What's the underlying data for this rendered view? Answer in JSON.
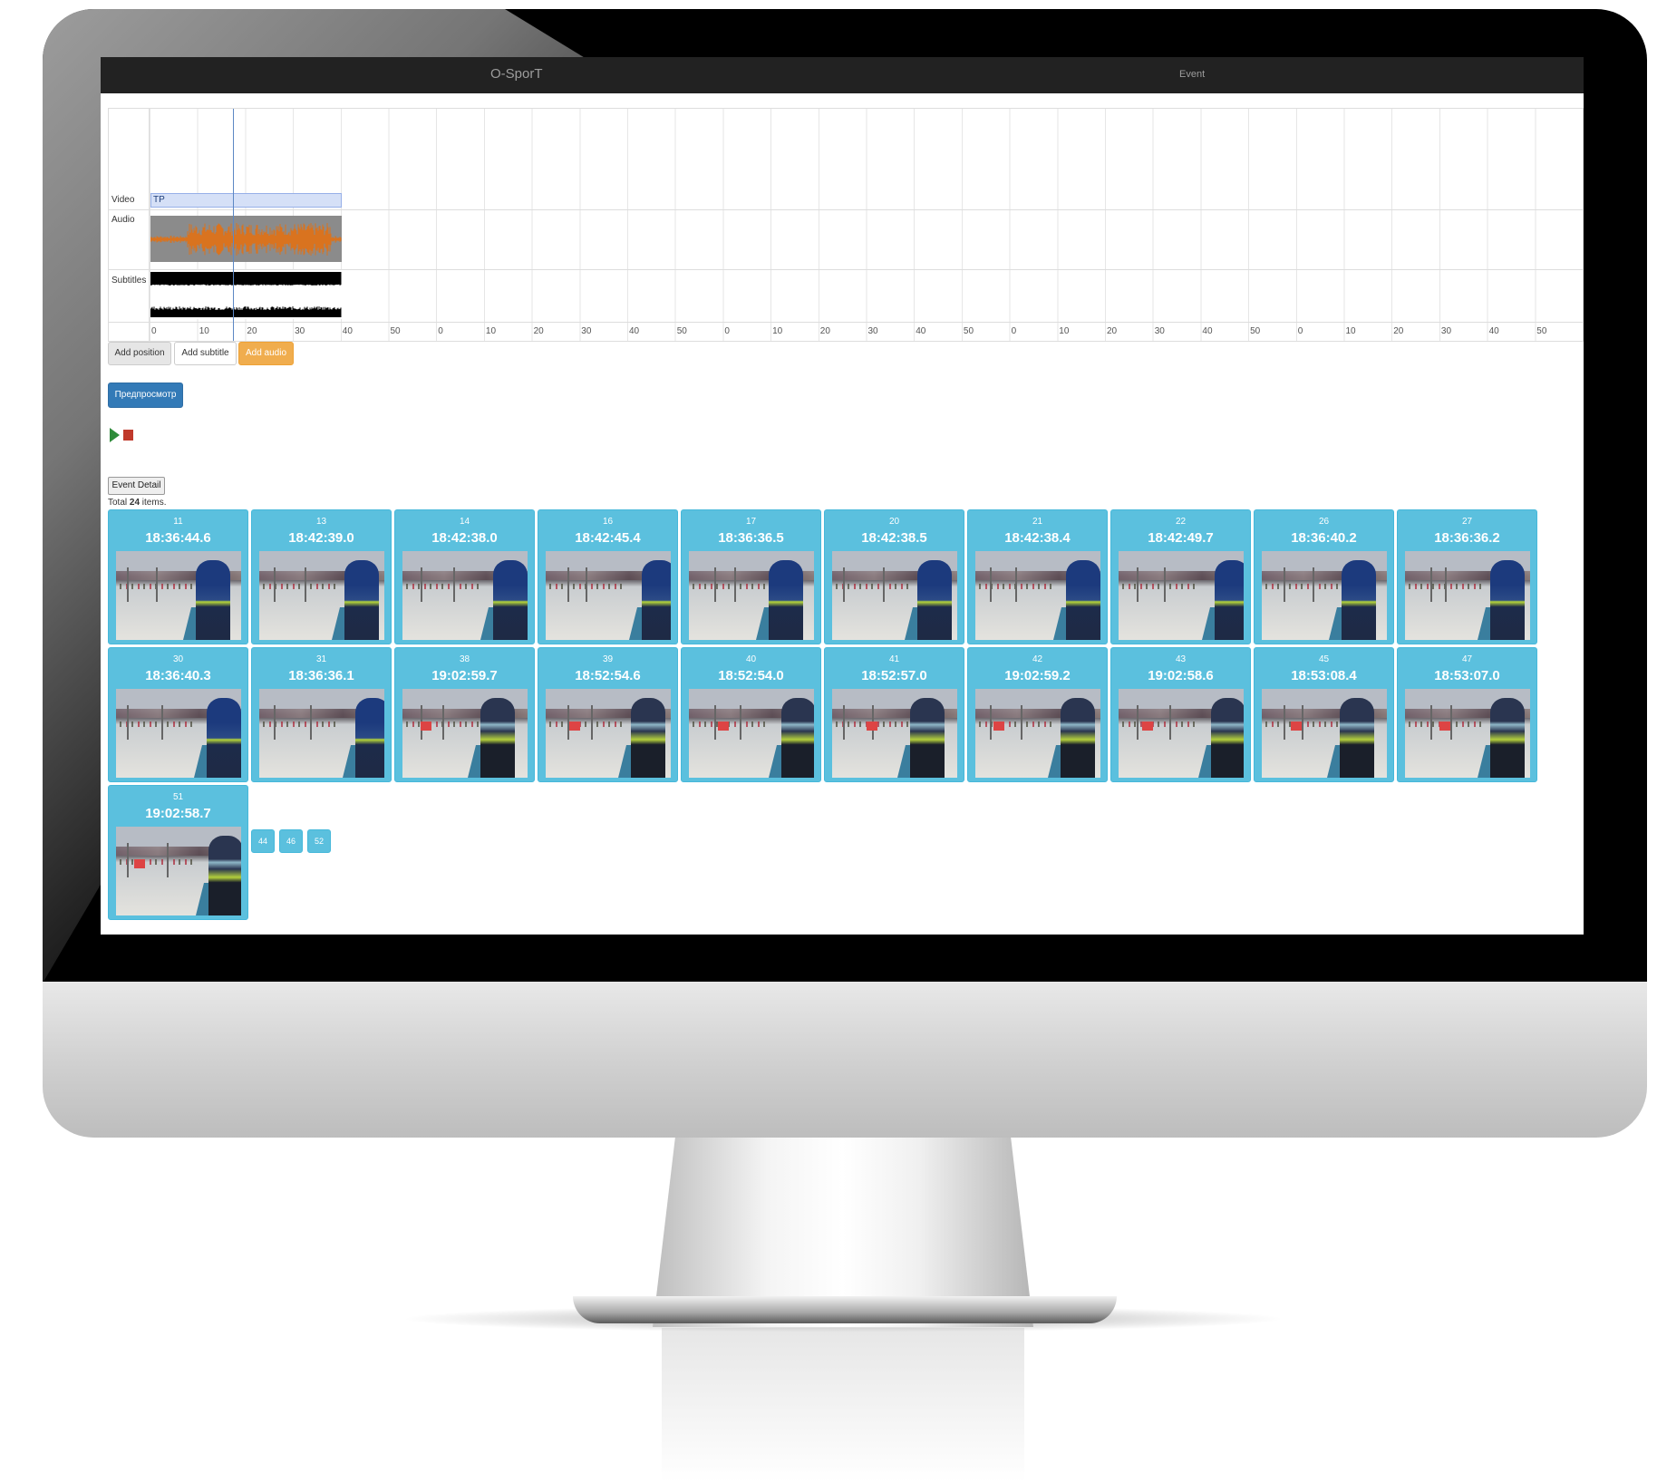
{
  "app": {
    "brand": "O-SporT",
    "nav_link": "Event"
  },
  "timeline": {
    "tracks": {
      "video": "Video",
      "audio": "Audio",
      "subtitles": "Subtitles"
    },
    "video_clip_label": "TP",
    "ticks": [
      "0",
      "10",
      "20",
      "30",
      "40",
      "50",
      "0",
      "10",
      "20",
      "30",
      "40",
      "50",
      "0",
      "10",
      "20",
      "30",
      "40",
      "50",
      "0",
      "10",
      "20",
      "30",
      "40",
      "50",
      "0",
      "10",
      "20",
      "30",
      "40",
      "50"
    ]
  },
  "buttons": {
    "add_position": "Add position",
    "add_subtitle": "Add subtitle",
    "add_audio": "Add audio",
    "preview": "Предпросмотр",
    "event_detail": "Event Detail"
  },
  "summary": {
    "prefix": "Total ",
    "count": "24",
    "suffix": " items."
  },
  "tiles": [
    {
      "id": "11",
      "time": "18:36:44.6"
    },
    {
      "id": "13",
      "time": "18:42:39.0"
    },
    {
      "id": "14",
      "time": "18:42:38.0"
    },
    {
      "id": "16",
      "time": "18:42:45.4"
    },
    {
      "id": "17",
      "time": "18:36:36.5"
    },
    {
      "id": "20",
      "time": "18:42:38.5"
    },
    {
      "id": "21",
      "time": "18:42:38.4"
    },
    {
      "id": "22",
      "time": "18:42:49.7"
    },
    {
      "id": "26",
      "time": "18:36:40.2"
    },
    {
      "id": "27",
      "time": "18:36:36.2"
    },
    {
      "id": "30",
      "time": "18:36:40.3"
    },
    {
      "id": "31",
      "time": "18:36:36.1"
    },
    {
      "id": "38",
      "time": "19:02:59.7"
    },
    {
      "id": "39",
      "time": "18:52:54.6"
    },
    {
      "id": "40",
      "time": "18:52:54.0"
    },
    {
      "id": "41",
      "time": "18:52:57.0"
    },
    {
      "id": "42",
      "time": "19:02:59.2"
    },
    {
      "id": "43",
      "time": "19:02:58.6"
    },
    {
      "id": "45",
      "time": "18:53:08.4"
    },
    {
      "id": "47",
      "time": "18:53:07.0"
    },
    {
      "id": "51",
      "time": "19:02:58.7"
    }
  ],
  "extra_items": [
    "44",
    "46",
    "52"
  ],
  "colors": {
    "tile": "#5bc0de",
    "navbar": "#222222",
    "primary": "#337ab7",
    "warning": "#f0ad4e",
    "audio_wave": "#d9731f"
  }
}
